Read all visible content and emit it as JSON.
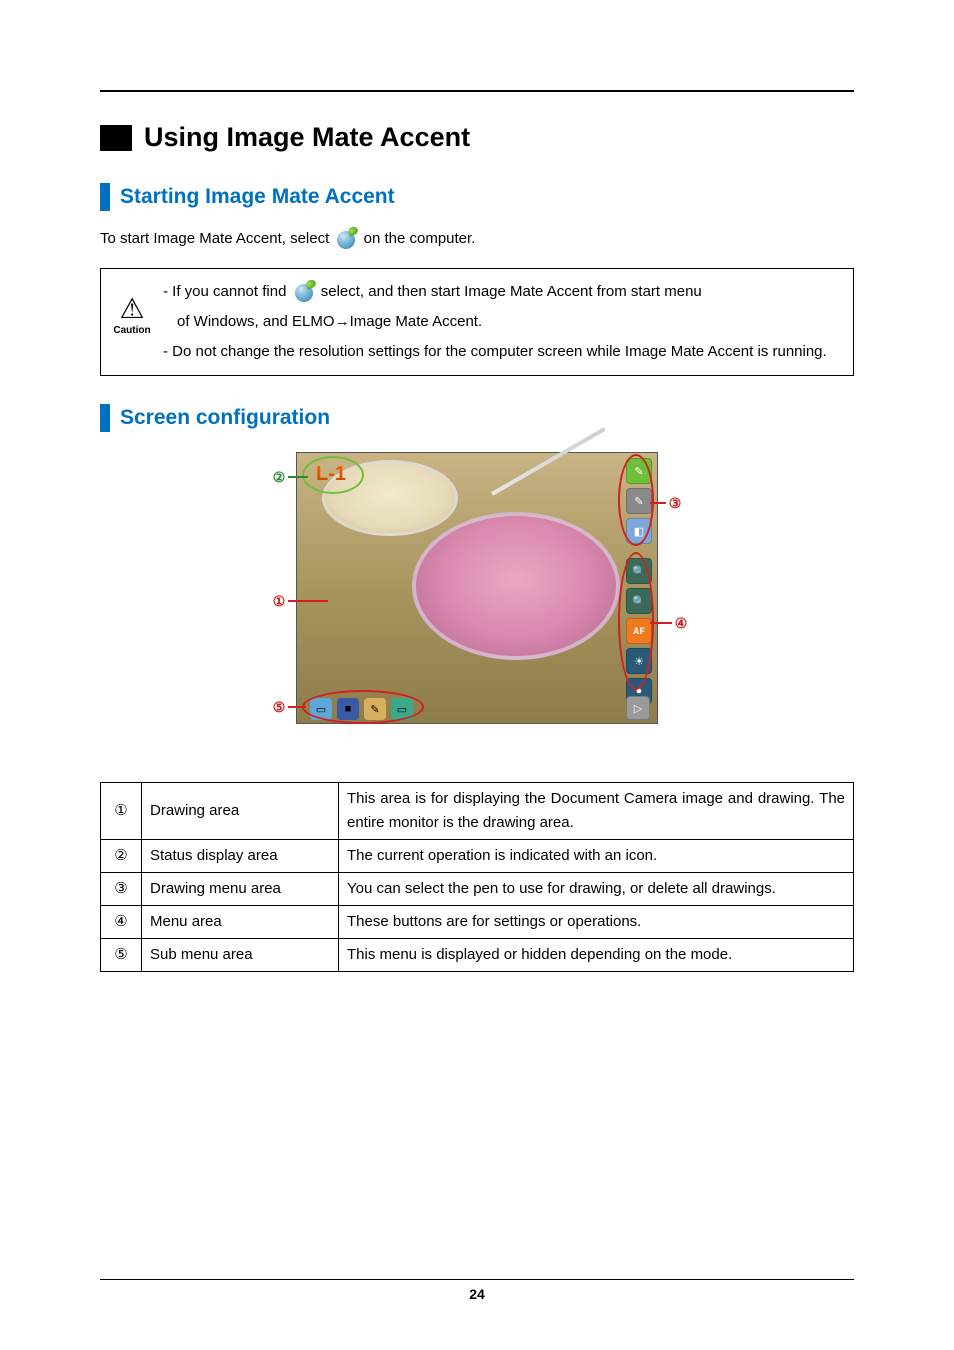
{
  "h1": "Using Image Mate Accent",
  "section1": {
    "title": "Starting Image Mate Accent",
    "intro_pre": "To start Image Mate Accent, select ",
    "intro_post": "on the computer."
  },
  "caution": {
    "label": "Caution",
    "line1_pre": "- If you cannot find ",
    "line1_post": " select, and then start Image Mate Accent from start menu",
    "line2": "of Windows, and ELMO→Image Mate Accent.",
    "line3": "- Do not change the resolution settings for the computer screen while Image Mate Accent is running."
  },
  "section2": {
    "title": "Screen configuration"
  },
  "screenshot": {
    "status_text": "L-1"
  },
  "table": {
    "rows": [
      {
        "num": "①",
        "name": "Drawing area",
        "desc": "This area is for displaying the Document Camera image and drawing. The entire monitor is the drawing area."
      },
      {
        "num": "②",
        "name": "Status display area",
        "desc": "The current operation is indicated with an icon."
      },
      {
        "num": "③",
        "name": "Drawing menu area",
        "desc": "You can select the pen to use for drawing, or delete all drawings."
      },
      {
        "num": "④",
        "name": "Menu area",
        "desc": "These buttons are for settings or operations."
      },
      {
        "num": "⑤",
        "name": "Sub menu area",
        "desc": "This menu is displayed or hidden depending on the mode."
      }
    ]
  },
  "markers": {
    "m1": "①",
    "m2": "②",
    "m3": "③",
    "m4": "④",
    "m5": "⑤"
  },
  "page_number": "24"
}
